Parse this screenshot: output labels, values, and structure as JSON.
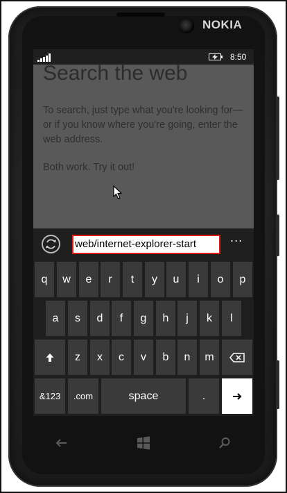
{
  "device": {
    "brand": "NOKIA"
  },
  "status_bar": {
    "time": "8:50",
    "icons": [
      "signal-icon",
      "battery-charging-icon"
    ]
  },
  "page": {
    "title": "Search the web",
    "description": "To search, just type what you're looking for—or if you know where you're going, enter the web address.",
    "tagline": "Both work. Try it out!"
  },
  "address_bar": {
    "refresh_icon": "refresh-icon",
    "url_value": "web/internet-explorer-start",
    "more_label": "..."
  },
  "keyboard": {
    "row1": [
      "q",
      "w",
      "e",
      "r",
      "t",
      "y",
      "u",
      "i",
      "o",
      "p"
    ],
    "row2": [
      "a",
      "s",
      "d",
      "f",
      "g",
      "h",
      "j",
      "k",
      "l"
    ],
    "row3": [
      "z",
      "x",
      "c",
      "v",
      "b",
      "n",
      "m"
    ],
    "shift_icon": "shift-arrow-icon",
    "backspace_icon": "backspace-icon",
    "symbols_label": "&123",
    "dotcom_label": ".com",
    "space_label": "space",
    "period_label": ".",
    "enter_icon": "enter-arrow-icon"
  },
  "hardware_nav": {
    "icons": [
      "back-icon",
      "windows-start-icon",
      "search-icon"
    ]
  },
  "colors": {
    "accent_error_border": "#e01b1b",
    "page_bg": "#595959",
    "key_bg": "#3a3a3a"
  }
}
